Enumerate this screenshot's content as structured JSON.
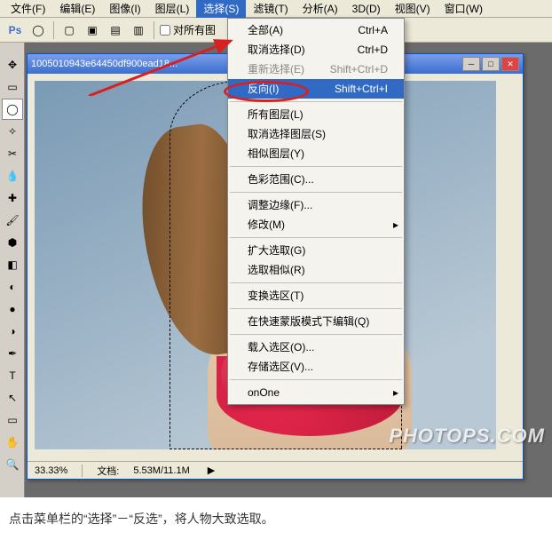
{
  "menubar": {
    "items": [
      {
        "label": "文件(F)"
      },
      {
        "label": "编辑(E)"
      },
      {
        "label": "图像(I)"
      },
      {
        "label": "图层(L)"
      },
      {
        "label": "选择(S)",
        "active": true
      },
      {
        "label": "滤镜(T)"
      },
      {
        "label": "分析(A)"
      },
      {
        "label": "3D(D)"
      },
      {
        "label": "视图(V)"
      },
      {
        "label": "窗口(W)"
      }
    ]
  },
  "toolbar": {
    "check_label": "对所有图"
  },
  "dropdown": {
    "items": [
      {
        "label": "全部(A)",
        "shortcut": "Ctrl+A"
      },
      {
        "label": "取消选择(D)",
        "shortcut": "Ctrl+D"
      },
      {
        "label": "重新选择(E)",
        "shortcut": "Shift+Ctrl+D",
        "disabled": true
      },
      {
        "label": "反向(I)",
        "shortcut": "Shift+Ctrl+I",
        "highlighted": true
      },
      {
        "sep": true
      },
      {
        "label": "所有图层(L)"
      },
      {
        "label": "取消选择图层(S)"
      },
      {
        "label": "相似图层(Y)"
      },
      {
        "sep": true
      },
      {
        "label": "色彩范围(C)..."
      },
      {
        "sep": true
      },
      {
        "label": "调整边缘(F)..."
      },
      {
        "label": "修改(M)",
        "submenu": true
      },
      {
        "sep": true
      },
      {
        "label": "扩大选取(G)"
      },
      {
        "label": "选取相似(R)"
      },
      {
        "sep": true
      },
      {
        "label": "变换选区(T)"
      },
      {
        "sep": true
      },
      {
        "label": "在快速蒙版模式下编辑(Q)"
      },
      {
        "sep": true
      },
      {
        "label": "载入选区(O)..."
      },
      {
        "label": "存储选区(V)..."
      },
      {
        "sep": true
      },
      {
        "label": "onOne",
        "submenu": true
      }
    ]
  },
  "document": {
    "title": "1005010943e64450df900ead18...",
    "zoom": "33.33%",
    "doc_label": "文档:",
    "doc_size": "5.53M/11.1M"
  },
  "caption": "点击菜单栏的“选择”－“反选”，将人物大致选取。",
  "watermark": "PHOTOPS.COM",
  "icons": {
    "ps": "Ps",
    "lasso": "◯",
    "move": "✥",
    "marquee": "▭",
    "wand": "✧",
    "crop": "✂",
    "eyedrop": "💧",
    "heal": "✚",
    "brush": "🖌",
    "stamp": "⬢",
    "eraser": "◧",
    "gradient": "◐",
    "blur": "●",
    "dodge": "◑",
    "pen": "✒",
    "type": "T",
    "path": "↖",
    "shape": "▭",
    "hand": "✋",
    "zoom": "🔍"
  }
}
